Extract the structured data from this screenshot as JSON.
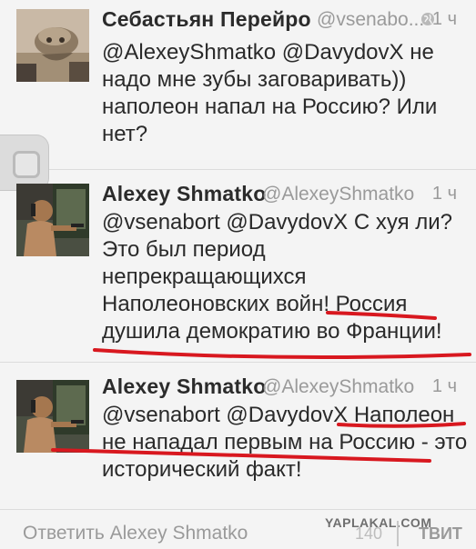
{
  "tweets": [
    {
      "name": "Себастьян   Перейро",
      "handle": "@vsenabo...",
      "time": "1 ч",
      "lines": [
        "@AlexeyShmatko @DavydovX не",
        "надо мне зубы заговаривать))",
        "наполеон напал на Россию? Или",
        "нет?"
      ]
    },
    {
      "name": "Alexey Shmatko",
      "handle": "@AlexeyShmatko",
      "time": "1 ч",
      "lines": [
        "@vsenabort @DavydovX  С хуя ли?",
        "Это был период",
        "непрекращающихся",
        "Наполеоновских войн! Россия",
        "душила демократию во Франции!"
      ]
    },
    {
      "name": "Alexey Shmatko",
      "handle": "@AlexeyShmatko",
      "time": "1 ч",
      "lines": [
        "@vsenabort @DavydovX Наполеон",
        "не нападал первым на Россию - это",
        "исторический факт!"
      ]
    }
  ],
  "footer": {
    "reply_placeholder": "Ответить Alexey Shmatko",
    "char_count": "140",
    "send_label": "ТВИТ",
    "watermark": "YAPLAKAL.COM"
  },
  "colors": {
    "background": "#f4f4f4",
    "text": "#2a2a2a",
    "secondary": "#9a9a9a",
    "annotation": "#d8181f"
  }
}
